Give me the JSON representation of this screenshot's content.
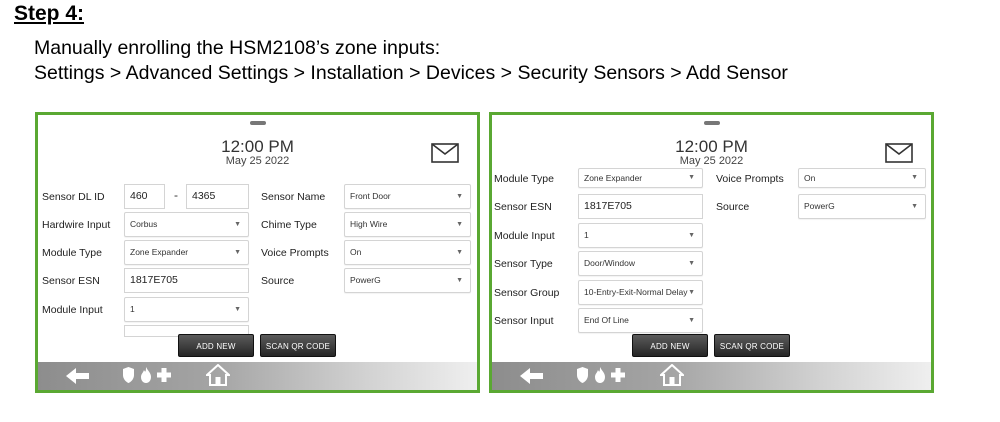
{
  "heading": {
    "step": "Step 4:"
  },
  "instructions": {
    "line1": "Manually enrolling the HSM2108’s zone inputs:",
    "line2": "Settings > Advanced Settings > Installation > Devices > Security Sensors > Add Sensor"
  },
  "colors": {
    "panel_border": "#5aa832",
    "button": "#3a3a3a"
  },
  "left_panel": {
    "time": "12:00 PM",
    "date": "May 25 2022",
    "sensor_dl_id": {
      "label": "Sensor DL ID",
      "part1": "460",
      "separator": "-",
      "part2": "4365"
    },
    "sensor_name": {
      "label": "Sensor Name",
      "value": "Front Door"
    },
    "hardwire_input": {
      "label": "Hardwire Input",
      "value": "Corbus"
    },
    "chime_type": {
      "label": "Chime Type",
      "value": "High Wire"
    },
    "module_type": {
      "label": "Module Type",
      "value": "Zone Expander"
    },
    "voice_prompts": {
      "label": "Voice Prompts",
      "value": "On"
    },
    "sensor_esn": {
      "label": "Sensor ESN",
      "value": "1817E705"
    },
    "source": {
      "label": "Source",
      "value": "PowerG"
    },
    "module_input": {
      "label": "Module Input",
      "value": "1"
    },
    "buttons": {
      "add_new": "ADD NEW",
      "scan_qr": "SCAN QR CODE"
    }
  },
  "right_panel": {
    "time": "12:00 PM",
    "date": "May 25 2022",
    "module_type": {
      "label": "Module Type",
      "value": "Zone Expander"
    },
    "voice_prompts": {
      "label": "Voice Prompts",
      "value": "On"
    },
    "sensor_esn": {
      "label": "Sensor ESN",
      "value": "1817E705"
    },
    "source": {
      "label": "Source",
      "value": "PowerG"
    },
    "module_input": {
      "label": "Module Input",
      "value": "1"
    },
    "sensor_type": {
      "label": "Sensor Type",
      "value": "Door/Window"
    },
    "sensor_group": {
      "label": "Sensor Group",
      "value": "10-Entry-Exit-Normal Delay"
    },
    "sensor_input": {
      "label": "Sensor Input",
      "value": "End Of Line"
    },
    "buttons": {
      "add_new": "ADD NEW",
      "scan_qr": "SCAN QR CODE"
    }
  },
  "nav_icons": [
    "back-arrow-icon",
    "shield-icon",
    "fire-icon",
    "medical-cross-icon",
    "home-icon"
  ]
}
